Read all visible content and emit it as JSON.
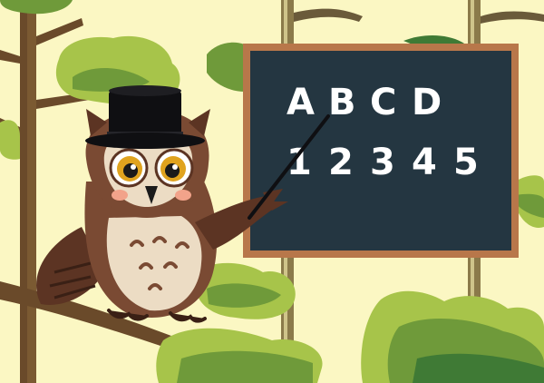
{
  "scene": {
    "board": {
      "letters": [
        "A",
        "B",
        "C",
        "D"
      ],
      "numbers": [
        "1",
        "2",
        "3",
        "4",
        "5"
      ]
    },
    "colors": {
      "background": "#fbf7c3",
      "board_fill": "#243641",
      "board_frame": "#b8774a",
      "owl_dark": "#5c3423",
      "owl_mid": "#7a4a33",
      "owl_belly": "#ecdcc4",
      "leaf_light": "#a7c44a",
      "leaf_mid": "#6f9a3a",
      "leaf_dark": "#3f7a35",
      "trunk": "#6a4a2a",
      "hat": "#0f0f12"
    }
  }
}
